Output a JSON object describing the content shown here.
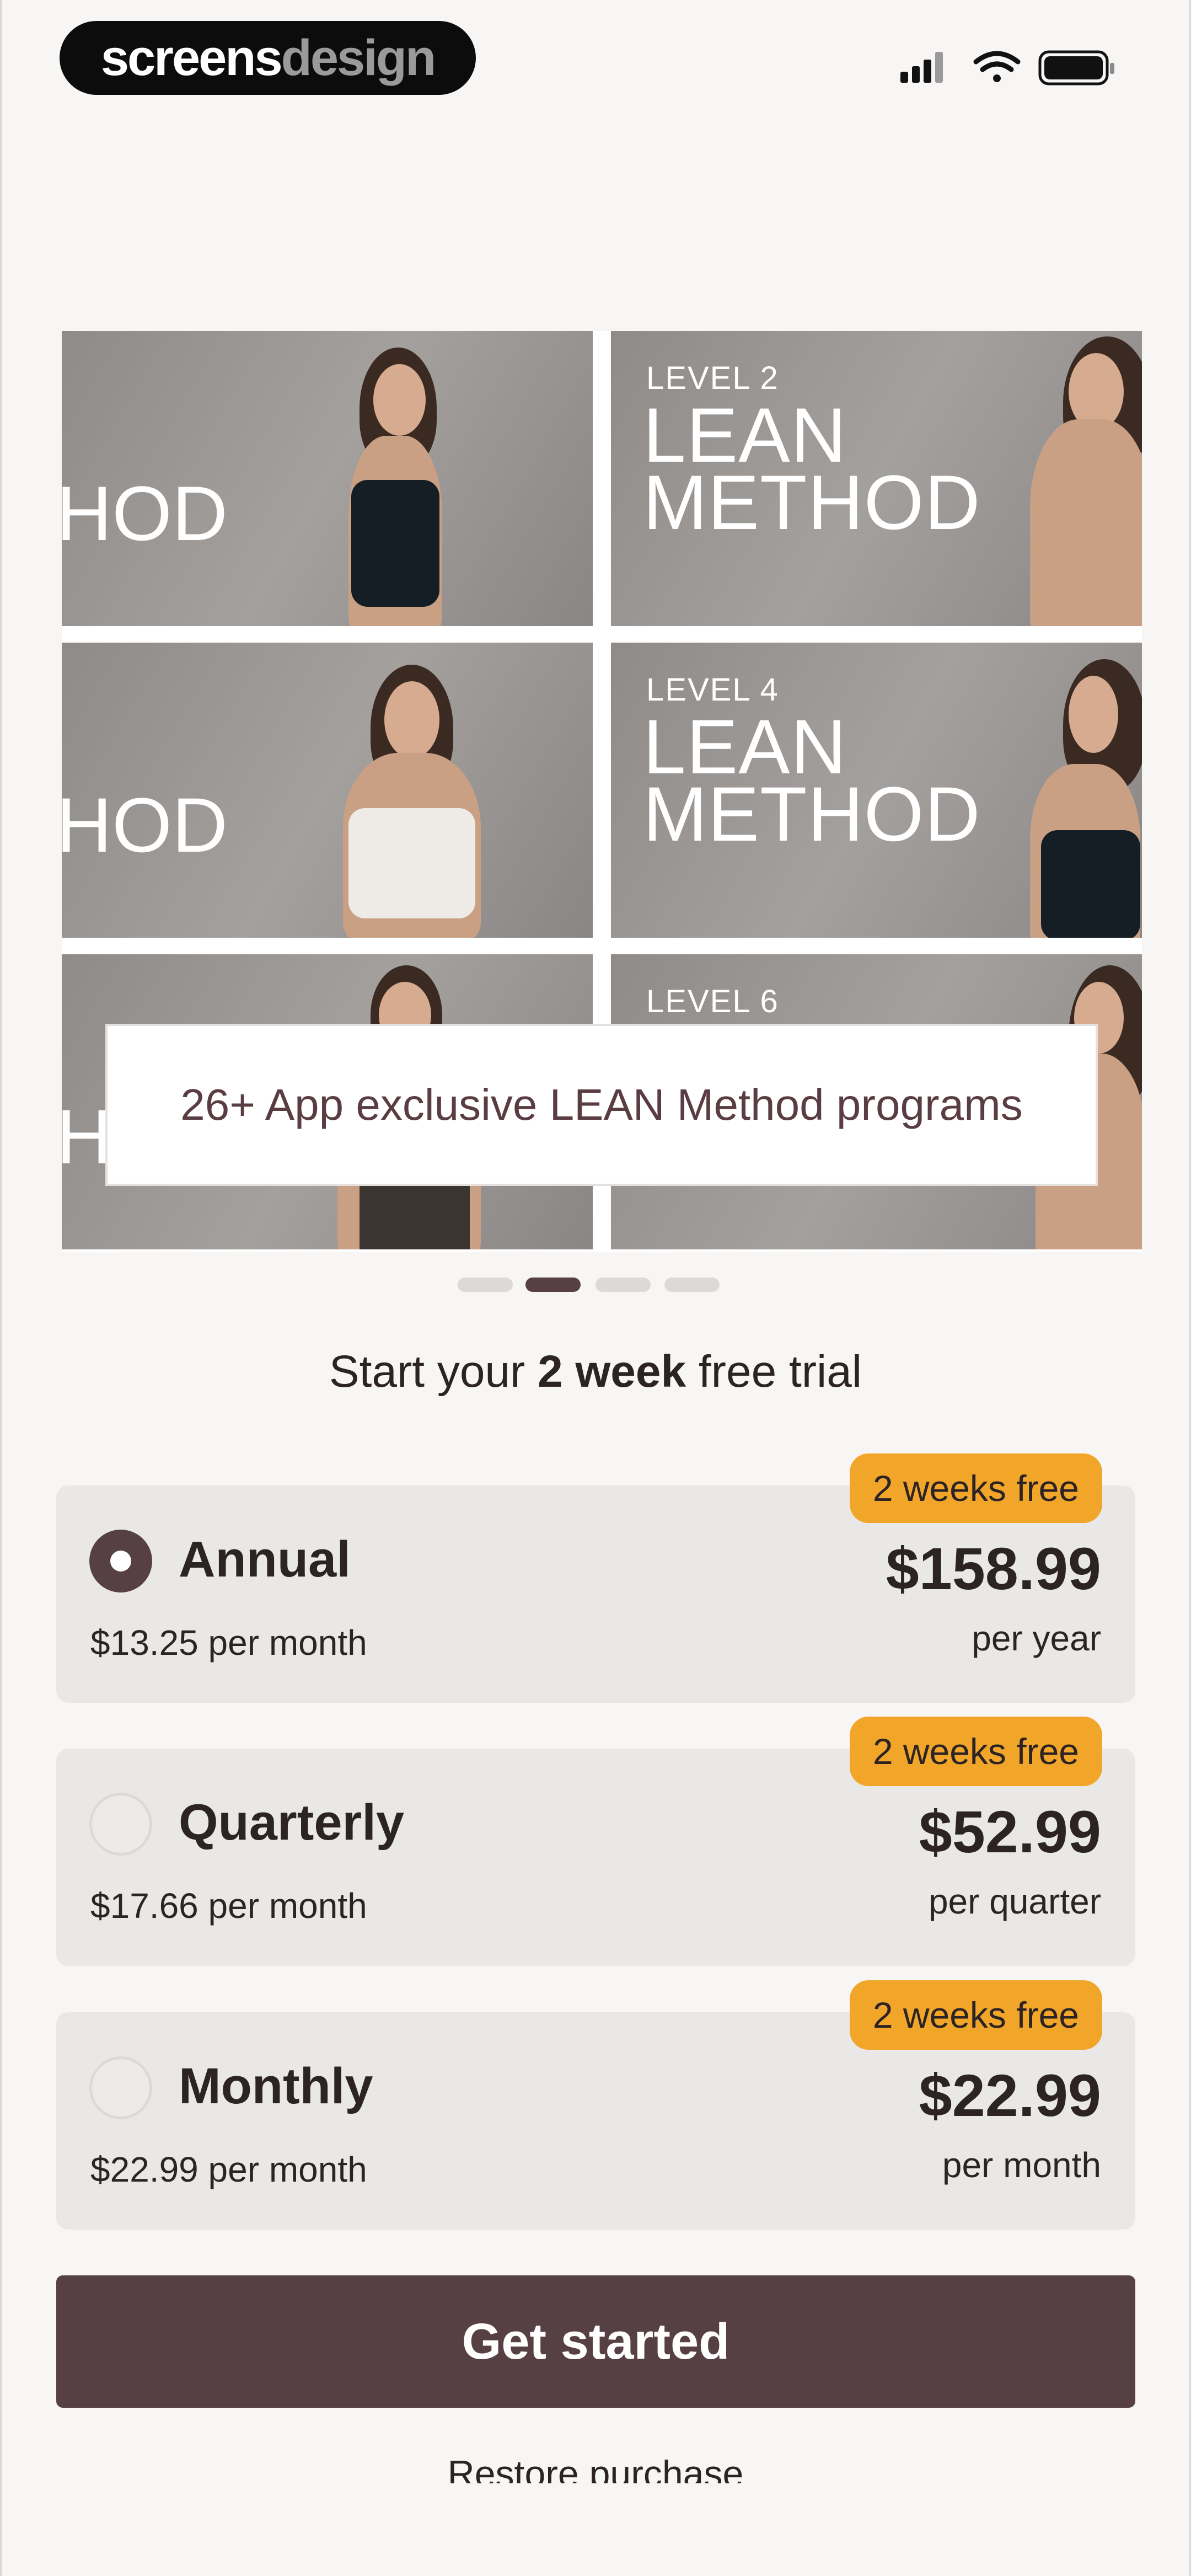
{
  "brand": {
    "part1": "screens",
    "part2": "design"
  },
  "carousel": {
    "tiles": [
      {
        "level": "",
        "title_line1": "",
        "title_line2": "HOD"
      },
      {
        "level": "LEVEL 2",
        "title_line1": "LEAN",
        "title_line2": "METHOD"
      },
      {
        "level": "",
        "title_line1": "",
        "title_line2": "HOD"
      },
      {
        "level": "LEVEL 4",
        "title_line1": "LEAN",
        "title_line2": "METHOD"
      },
      {
        "level": "",
        "title_line1": "",
        "title_line2": "H"
      },
      {
        "level": "LEVEL 6",
        "title_line1": "",
        "title_line2": ""
      }
    ],
    "promo": "26+ App exclusive LEAN Method programs",
    "page_count": 4,
    "active_page": 2
  },
  "trial": {
    "prefix": "Start your ",
    "bold": "2 week",
    "suffix": " free trial"
  },
  "plans": [
    {
      "name": "Annual",
      "monthly": "$13.25 per month",
      "badge": "2 weeks free",
      "price": "$158.99",
      "period": "per year",
      "selected": true
    },
    {
      "name": "Quarterly",
      "monthly": "$17.66 per month",
      "badge": "2 weeks free",
      "price": "$52.99",
      "period": "per quarter",
      "selected": false
    },
    {
      "name": "Monthly",
      "monthly": "$22.99 per month",
      "badge": "2 weeks free",
      "price": "$22.99",
      "period": "per month",
      "selected": false
    }
  ],
  "cta_label": "Get started",
  "restore_label": "Restore purchase",
  "colors": {
    "accent": "#574044",
    "badge": "#f2a629",
    "card": "#e9e8e6"
  },
  "icons": [
    "cellular-signal-icon",
    "wifi-icon",
    "battery-icon"
  ]
}
